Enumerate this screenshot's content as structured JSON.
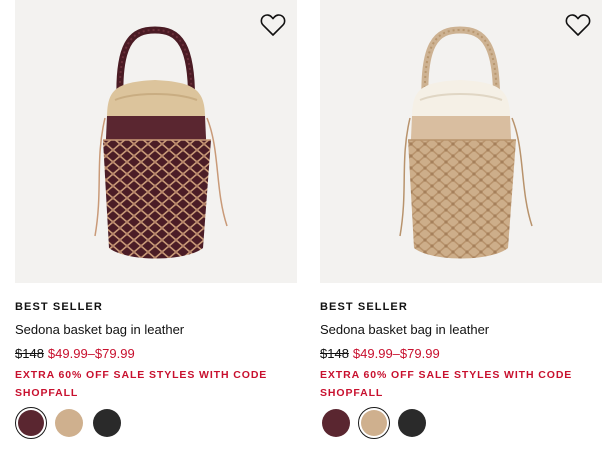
{
  "products": [
    {
      "badge": "BEST SELLER",
      "name": "Sedona basket bag in leather",
      "original_price": "$148",
      "sale_price": "$49.99–$79.99",
      "promo": "EXTRA 60% OFF SALE STYLES WITH CODE SHOPFALL",
      "favorite_icon": "heart-outline-icon",
      "bag_color": "#5a2630",
      "inner_color": "#d9c29a",
      "selected_swatch": 0,
      "swatches": [
        {
          "name": "burgundy",
          "color": "#5a2630"
        },
        {
          "name": "natural",
          "color": "#cfb08e"
        },
        {
          "name": "black",
          "color": "#2a2a2a"
        }
      ]
    },
    {
      "badge": "BEST SELLER",
      "name": "Sedona basket bag in leather",
      "original_price": "$148",
      "sale_price": "$49.99–$79.99",
      "promo": "EXTRA 60% OFF SALE STYLES WITH CODE SHOPFALL",
      "favorite_icon": "heart-outline-icon",
      "bag_color": "#d6b895",
      "inner_color": "#f4efe6",
      "selected_swatch": 1,
      "swatches": [
        {
          "name": "burgundy",
          "color": "#5a2630"
        },
        {
          "name": "natural",
          "color": "#cfb08e"
        },
        {
          "name": "black",
          "color": "#2a2a2a"
        }
      ]
    }
  ]
}
